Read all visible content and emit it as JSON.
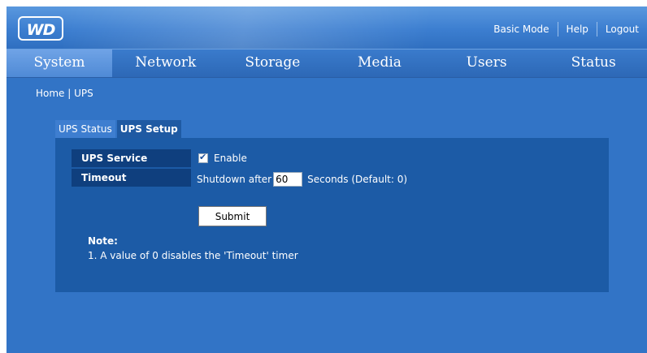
{
  "header": {
    "logo_text": "WD",
    "links": {
      "basic_mode": "Basic Mode",
      "help": "Help",
      "logout": "Logout"
    }
  },
  "nav": {
    "tabs": [
      {
        "label": "System",
        "active": true
      },
      {
        "label": "Network",
        "active": false
      },
      {
        "label": "Storage",
        "active": false
      },
      {
        "label": "Media",
        "active": false
      },
      {
        "label": "Users",
        "active": false
      },
      {
        "label": "Status",
        "active": false
      }
    ]
  },
  "breadcrumb": {
    "home": "Home",
    "separator": "|",
    "current": "UPS"
  },
  "subtabs": {
    "status": "UPS Status",
    "setup": "UPS Setup"
  },
  "form": {
    "service_label": "UPS Service",
    "enable_label": "Enable",
    "enable_checked": true,
    "timeout_label": "Timeout",
    "shutdown_prefix": "Shutdown after",
    "timeout_value": "60",
    "timeout_suffix": "Seconds  (Default: 0)",
    "submit_label": "Submit"
  },
  "note": {
    "title": "Note:",
    "lines": [
      "1.  A value of 0 disables the 'Timeout' timer"
    ]
  },
  "colors": {
    "background": "#3274c6",
    "panel": "#1c5ba6",
    "label_cell": "#0f3f7e"
  }
}
